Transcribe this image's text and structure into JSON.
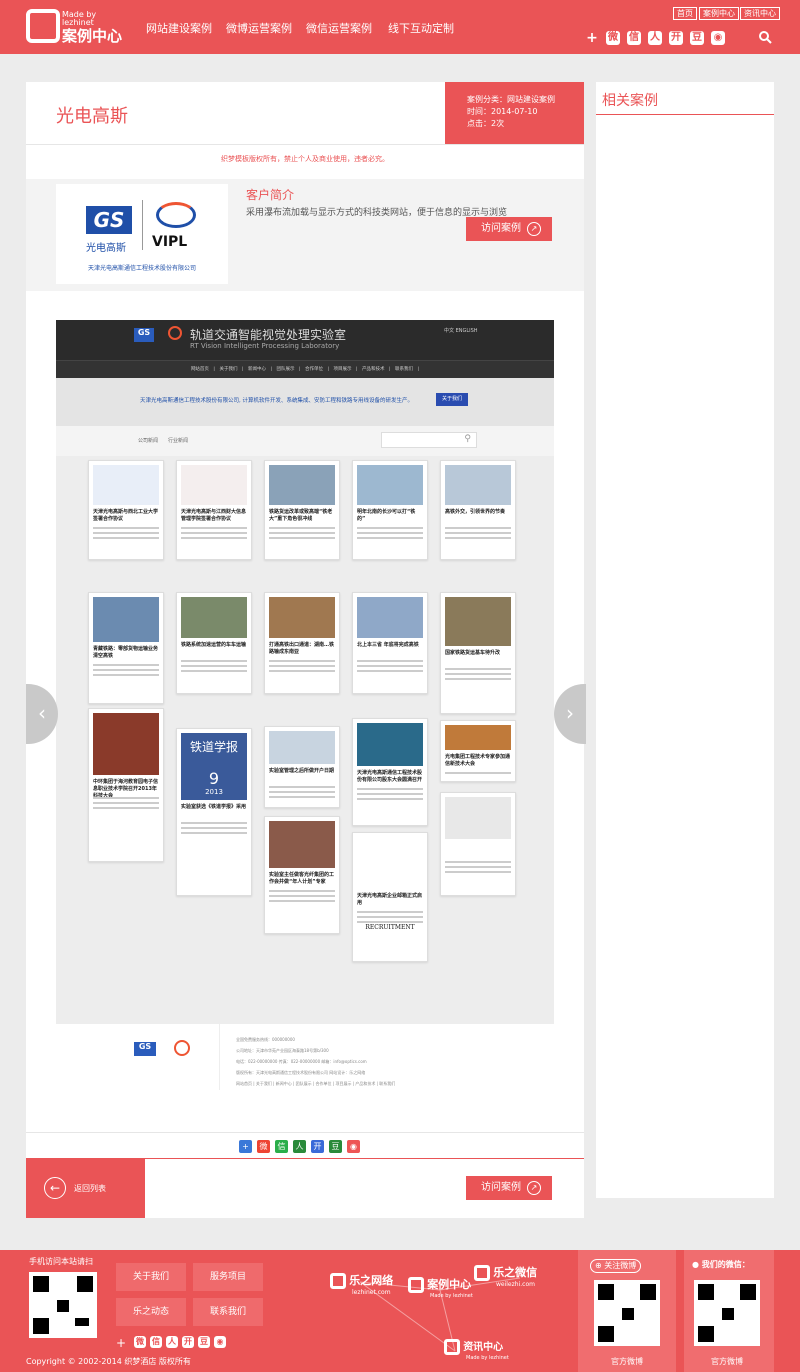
{
  "header": {
    "logo_small_1": "Made by",
    "logo_small_2": "lezhinet",
    "logo_big": "案例中心",
    "nav": [
      "网站建设案例",
      "微博运营案例",
      "微信运营案例",
      "线下互动定制"
    ],
    "top_links": [
      "首页",
      "案例中心",
      "资讯中心"
    ],
    "social_icons": [
      "plus-icon",
      "weibo-icon",
      "wechat-icon",
      "renren-icon",
      "kaixin-icon",
      "douban-icon",
      "other-icon"
    ],
    "search_icon": "search-icon",
    "accent": "#ea5456"
  },
  "case": {
    "title": "光电高斯",
    "category": "案例分类：网站建设案例",
    "time": "时间：2014-07-10",
    "clicks": "点击：2次",
    "notice": "织梦模板版权所有，禁止个人及商业使用，违者必究。",
    "client_name": "天津光电高斯通信工程技术股份有限公司",
    "logo_left": "光电高斯",
    "logo_right": "VIPL",
    "intro_title": "客户简介",
    "intro_text": "采用瀑布流加载与显示方式的科技类网站，便于信息的显示与浏览",
    "visit_label": "访问案例",
    "back_label": "返回列表"
  },
  "shot": {
    "site_title": "轨道交通智能视觉处理实验室",
    "site_subtitle": "RT Vision Intelligent Processing Laboratory",
    "lang": "中文    ENGLISH",
    "nav": "网站首页　|　关于我们　|　新闻中心　|　团队展示　|　合作单位　|　项目展示　|　产品和技术　|　联系我们　|",
    "band_text": "天津光电高斯通信工程技术股份有限公司, 计算机软件开发、系统集成、安防工程和铁路专用线设备的研发生产。",
    "band_btn": "关于我们",
    "filters": "公司新闻　　行业新闻",
    "cards": [
      "天津光电高斯与西北工业大学签署合作协议",
      "天津光电高斯与江西财大信息管理学院签署合作协议",
      "铁路货运改革或致高端“铁老大”重下角色很冲线",
      "明年北南的长沙可以打“铁的”",
      "高铁外交，引领世界的节奏",
      "青藏铁路：零部货物运输业务清空高铁",
      "铁路系统加速运营的车车运输",
      "打通高铁出口通道：湖南…铁路输成东南亚",
      "北上本三省 年底将完成高铁",
      "国家铁路货运基车待升改",
      "中环集团于海河教育园电子信息职业技术学院召开2013年科技大会",
      "实验室获选《铁道学报》采用",
      "实验室管理之后所做开户日期",
      "天津光电高斯通信工程技术股份有限公司股东大会圆满召开",
      "光电集团工程技术专家参加通信新技术大会",
      "实验室主任做客光纤集团的工作会并做“年人计划”专家",
      "天津光电高斯企业邮箱正式启用"
    ],
    "journal": "铁道学报",
    "journal_num": "9",
    "journal_year": "2013",
    "recruit": "RECRUITMENT",
    "foot_lines": [
      "全国免费服务热线：000000000",
      "公司地址：天津市华苑产业园区海泰路18号第b/300",
      "电话：022-00000000  传真：022-00000000  邮箱：info@optics.com",
      "版权所有：天津光电高斯通信工程技术股份有限公司  网站设计：乐之网络",
      "网站首页 | 关于我们 | 新闻中心 | 团队展示 | 合作单位 | 项目展示 | 产品和技术 | 联系我们"
    ]
  },
  "share_icons": [
    "plus-icon",
    "weibo-icon",
    "wechat-icon",
    "renren-icon",
    "kaixin-icon",
    "douban-icon",
    "other-icon"
  ],
  "side": {
    "title": "相关案例"
  },
  "footer": {
    "scan_text": "手机访问本站请扫",
    "buttons": [
      "关于我们",
      "服务项目",
      "乐之动态",
      "联系我们"
    ],
    "brands": [
      "乐之网络",
      "案例中心",
      "乐之微信",
      "资讯中心"
    ],
    "brand_subs": [
      "lezhinet.com",
      "Made by lezhinet",
      "weilezhi.com",
      "Made by lezhinet"
    ],
    "follow_weibo": "关注微博",
    "our_wechat": "我们的微信：",
    "official_weibo": "官方微博",
    "official_wechat": "官方微博",
    "copyright": "Copyright © 2002-2014 织梦酒店 版权所有"
  }
}
